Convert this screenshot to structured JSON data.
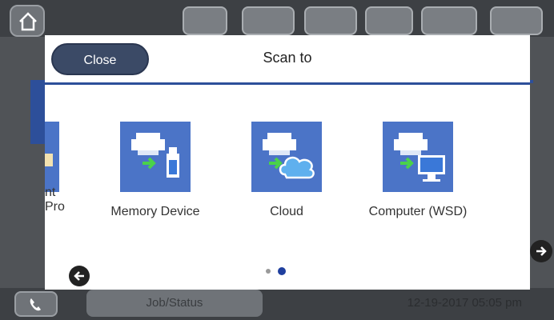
{
  "dialog": {
    "title": "Scan to",
    "close_label": "Close"
  },
  "tiles": [
    {
      "label_line1": "nt",
      "label_line2": "Pro",
      "icon": "partial-icon"
    },
    {
      "label": "Memory Device",
      "icon": "memory-device-icon"
    },
    {
      "label": "Cloud",
      "icon": "cloud-icon"
    },
    {
      "label": "Computer (WSD)",
      "icon": "computer-wsd-icon"
    }
  ],
  "pagination": {
    "current": 2,
    "total": 2
  },
  "background": {
    "job_status_label": "Job/Status",
    "datetime": "12-19-2017 05:05 pm"
  },
  "colors": {
    "tile_blue": "#4b74c7",
    "close_button": "#3b4a66",
    "accent_line": "#2d4f9a",
    "active_dot": "#1f3f9e"
  }
}
